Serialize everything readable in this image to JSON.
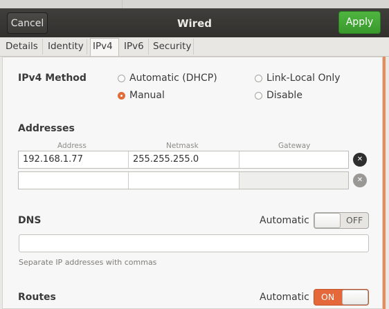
{
  "window": {
    "title": "Wired"
  },
  "header": {
    "cancel_label": "Cancel",
    "apply_label": "Apply"
  },
  "tabs": [
    {
      "label": "Details"
    },
    {
      "label": "Identity"
    },
    {
      "label": "IPv4",
      "active": true
    },
    {
      "label": "IPv6"
    },
    {
      "label": "Security"
    }
  ],
  "ipv4_method": {
    "label": "IPv4 Method",
    "options": [
      {
        "label": "Automatic (DHCP)",
        "checked": false
      },
      {
        "label": "Link-Local Only",
        "checked": false
      },
      {
        "label": "Manual",
        "checked": true
      },
      {
        "label": "Disable",
        "checked": false
      }
    ]
  },
  "addresses": {
    "label": "Addresses",
    "columns": [
      "Address",
      "Netmask",
      "Gateway"
    ],
    "rows": [
      {
        "address": "192.168.1.77",
        "netmask": "255.255.255.0",
        "gateway": ""
      },
      {
        "address": "",
        "netmask": "",
        "gateway": ""
      }
    ],
    "delete_icon": "close-circle-icon"
  },
  "dns": {
    "label": "DNS",
    "auto_label": "Automatic",
    "toggle": {
      "state": "OFF"
    },
    "input_value": "",
    "hint": "Separate IP addresses with commas"
  },
  "routes": {
    "label": "Routes",
    "auto_label": "Automatic",
    "toggle": {
      "state": "ON"
    }
  },
  "colors": {
    "accent": "#e06d3a",
    "apply": "#3fa532",
    "header": "#363532"
  }
}
